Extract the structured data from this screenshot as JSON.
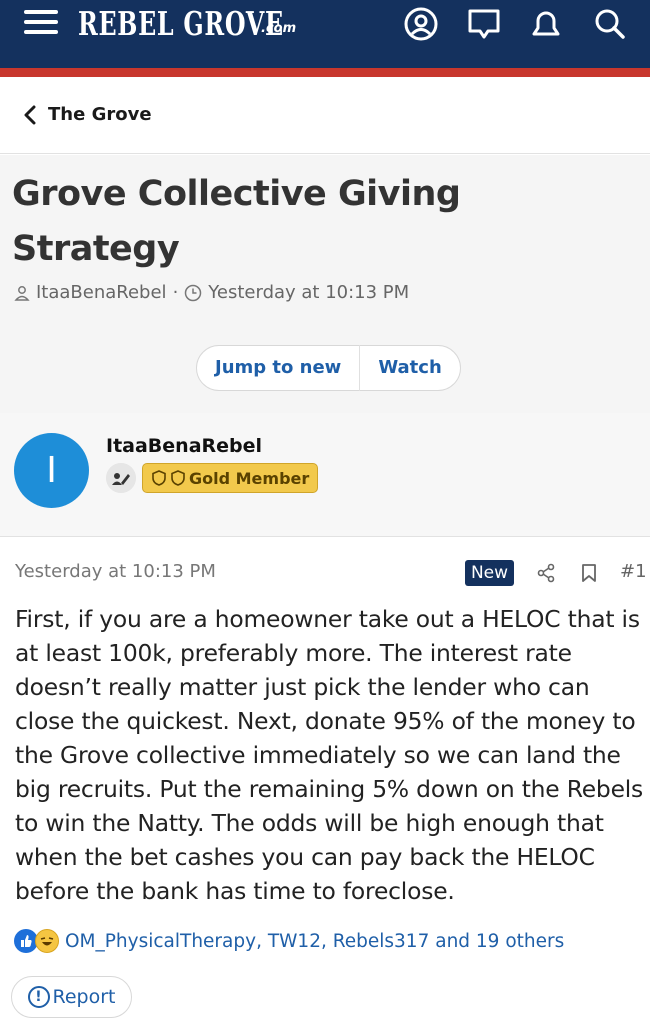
{
  "header": {
    "logo_main": "REBEL GROVE",
    "logo_suffix": ".com",
    "icons": [
      "menu-icon",
      "account-icon",
      "messages-icon",
      "alerts-icon",
      "search-icon"
    ],
    "colors": {
      "nav_bg": "#14315e",
      "accent_stripe": "#c8372d",
      "link": "#1f5fa8"
    }
  },
  "breadcrumb": {
    "back_label": "The Grove"
  },
  "thread": {
    "title": "Grove Collective Giving Strategy",
    "author": "ItaaBenaRebel",
    "date": "Yesterday at 10:13 PM",
    "jump_label": "Jump to new",
    "watch_label": "Watch"
  },
  "user": {
    "avatar_letter": "I",
    "name": "ItaaBenaRebel",
    "badge": "Gold Member"
  },
  "post": {
    "date": "Yesterday at 10:13 PM",
    "new_badge": "New",
    "number": "#1",
    "body": "First, if you are a homeowner take out a HELOC that is at least 100k, preferably more. The interest rate doesn’t really matter just pick the lender who can close the quickest. Next, donate 95% of the money to the Grove collective immediately so we can land the big recruits. Put the remaining 5% down on the Rebels to win the Natty. The odds will be high enough that when the bet cashes you can pay back the HELOC before the bank has time to foreclose.",
    "reactions_text": "OM_PhysicalTherapy, TW12, Rebels317 and 19 others",
    "report_label": "Report"
  }
}
